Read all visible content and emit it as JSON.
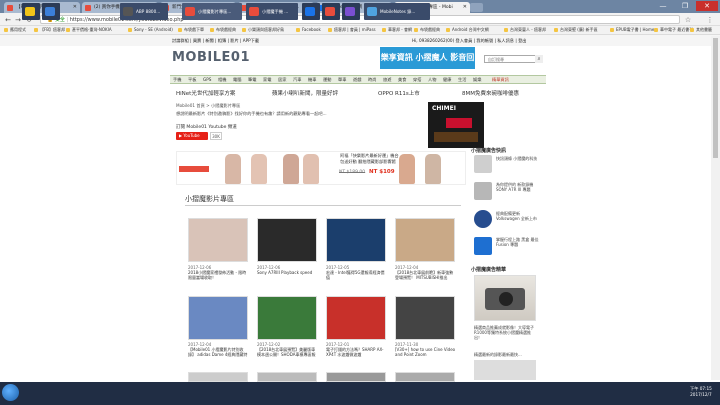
{
  "browser": {
    "tabs": [
      {
        "label": "【FB】痞客邦",
        "color": "#e74c3c",
        "active": false
      },
      {
        "label": "(2) 買你手機的影像的 [蘇]...",
        "color": "#e74c3c",
        "active": false
      },
      {
        "label": "新門文章 - Mobile01",
        "color": "#e74c3c",
        "active": false
      },
      {
        "label": "簽名檔 - 2016 小 [蘇]...",
        "color": "#e74c3c",
        "active": false
      },
      {
        "label": "Mobile01 - 蓋網",
        "color": "#1a73e8",
        "active": false
      },
      {
        "label": "小摺魔影片專區 - Mobi",
        "color": "#e74c3c",
        "active": true
      }
    ],
    "window_controls": [
      "—",
      "❐",
      "✕"
    ],
    "address": "https://www.mobile01.com/youtubevideo.php",
    "address_label": "安全",
    "bookmarks": [
      "應用程式",
      "【FB】痞客邦",
      "甚平價格-重灣-NOKIA",
      "Sony - SE (Android)",
      "布袋戲下單",
      "布袋戲經典",
      "小樂頭與痞客邦好鳥",
      "Facebook",
      "痞客邦 | 會員 | miPass",
      "華客邦 - 會網",
      "布袋戲經典",
      "Android 台灣中文網",
      "台灣東臺人 - 痞客邦",
      "台灣東堅 (廣) 新手區",
      "EPUB電子書 | Home",
      "華中電子 最近書刊",
      "其他書籤"
    ]
  },
  "site": {
    "top_links": [
      "討論群組",
      "買賣",
      "新聞",
      "相簿",
      "影片",
      "APP下載"
    ],
    "top_right": [
      "Hi, 0938260262(00) 登入會員",
      "我的帳號",
      "私人訊息",
      "登出"
    ],
    "logo": "MOBILE01",
    "banner_text": "樂享資訊 小摺魔人 影音回顧",
    "search_placeholder": "自訂搜尋",
    "categories": [
      "手機",
      "平板",
      "GPS",
      "相機",
      "電腦",
      "筆電",
      "家電",
      "居家",
      "汽車",
      "機車",
      "運動",
      "單車",
      "遊戲",
      "時尚",
      "旅遊",
      "美食",
      "穿搭",
      "人物",
      "健康",
      "生活",
      "娛樂",
      "精華資訊"
    ],
    "promo_links": [
      "HiNet光世代加輕享方案",
      "蘋果小喇叭新聞，限量好評",
      "OPPO R11s上市",
      "8MM免費來碗咖啡優惠"
    ],
    "breadcrumb": "Mobile01 首頁 > 小摺魔影片專區",
    "description": "想說明最新影片《特別邀稿影》找好你的手機也有趣？請用新的觀點專看一起吧...",
    "youtube_line": "訂閱 Mobile01 Youtube 頻道",
    "youtube_button": "YouTube",
    "youtube_count": "30K",
    "ad_text": "阿福「快樂影片最新好運」機台包送好動 翻拍隱藏影部影響館",
    "price_old": "NT $189.00",
    "price_new": "NT $109",
    "section_title": "小摺魔影片專區",
    "videos": [
      {
        "date": "2017-12-06",
        "title": "2018小摺魔家禮發佈活動 - 限時限量當場收取！",
        "color": "#d9c3b8"
      },
      {
        "date": "2017-12-06",
        "title": "Sony A7RIII Playback speed",
        "color": "#2a2a2a"
      },
      {
        "date": "2017-12-05",
        "title": "宏達 - Intel獲得5G還報導經濟價值",
        "color": "#1b3e6c"
      },
      {
        "date": "2017-12-04",
        "title": "【2018台北車展前瞻】新車強勢登場預覽！ MITSUBISHI推出",
        "color": "#c9a987"
      },
      {
        "date": "2017-12-04",
        "title": "【Mobile01 小摺魔影片特別收錄】 adidas Dame 4經典隱藏特",
        "color": "#6a89c2"
      },
      {
        "date": "2017-12-02",
        "title": "【2018台北車展預覽】美麗版車模本週公開！SHODA車模專區報",
        "color": "#3a7a3a"
      },
      {
        "date": "2017-12-01",
        "title": "電子打錢的方法嗎？SHARP AX-XP4T 水波爐微波爐",
        "color": "#c8302a"
      },
      {
        "date": "2017-11-30",
        "title": "[V30+] how to use Cine Video and Point Zoom",
        "color": "#444444"
      }
    ],
    "sidebar": {
      "head1": "小摺魔廣告快訊",
      "items1": [
        {
          "text": "快訊頭條 小摺魔的科技",
          "color": "#cfcfcf"
        },
        {
          "text": "為你提供的 新款錄機 SONY A7R III 專題",
          "color": "#b7b7b7"
        },
        {
          "text": "經典配備更新 Volkswagen 全新上市",
          "color": "#274d8f"
        },
        {
          "text": "掌握行程上路 黑盒 最佳 Fusion 專題",
          "color": "#1e6fd1"
        }
      ],
      "head2": "小摺魔廣告精華",
      "caption2": "精選商品推薦成就影像！大導電子R1000等獨特系統小摺魔精選推出！",
      "footer": "精選最新的錄影最新最快..."
    }
  },
  "taskbar": {
    "apps": [
      {
        "label": "",
        "color": "#f0c419"
      },
      {
        "label": "",
        "color": "#3b7fd9"
      },
      {
        "label": "ABP 8800...",
        "color": "#555555"
      },
      {
        "label": "小摺魔影片專區...",
        "color": "#e74c3c"
      },
      {
        "label": "小摺魔手機 ...",
        "color": "#e74c3c"
      },
      {
        "label": "",
        "color": "#1a73e8"
      },
      {
        "label": "",
        "color": "#e74c3c"
      },
      {
        "label": "",
        "color": "#7a4fd1"
      },
      {
        "label": "MobileNotes 錄...",
        "color": "#4fa3e0"
      }
    ],
    "time": "下午 07:15",
    "date": "2017/12/7"
  }
}
